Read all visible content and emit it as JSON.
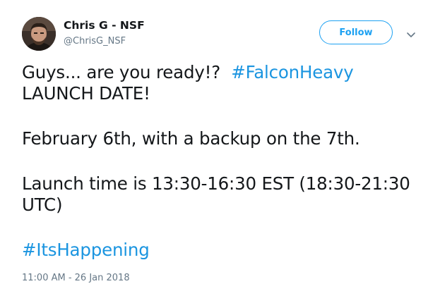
{
  "author": {
    "display_name": "Chris G - NSF",
    "handle": "@ChrisG_NSF",
    "avatar_icon": "profile-photo"
  },
  "actions": {
    "follow_label": "Follow",
    "more_icon": "chevron-down-icon"
  },
  "tweet": {
    "line1_text": "Guys... are you ready!?",
    "line1_hashtag": "#FalconHeavy",
    "line2_text": "LAUNCH DATE!",
    "line3_text": "February 6th, with a backup on the 7th.",
    "line4_text": "Launch time is 13:30-16:30 EST (18:30-21:30 UTC)",
    "hashtag2": "#ItsHappening",
    "timestamp": "11:00 AM - 26 Jan 2018"
  },
  "colors": {
    "link": "#1b95e0",
    "follow_accent": "#1da1f2",
    "secondary_text": "#657786",
    "primary_text": "#14171a"
  }
}
